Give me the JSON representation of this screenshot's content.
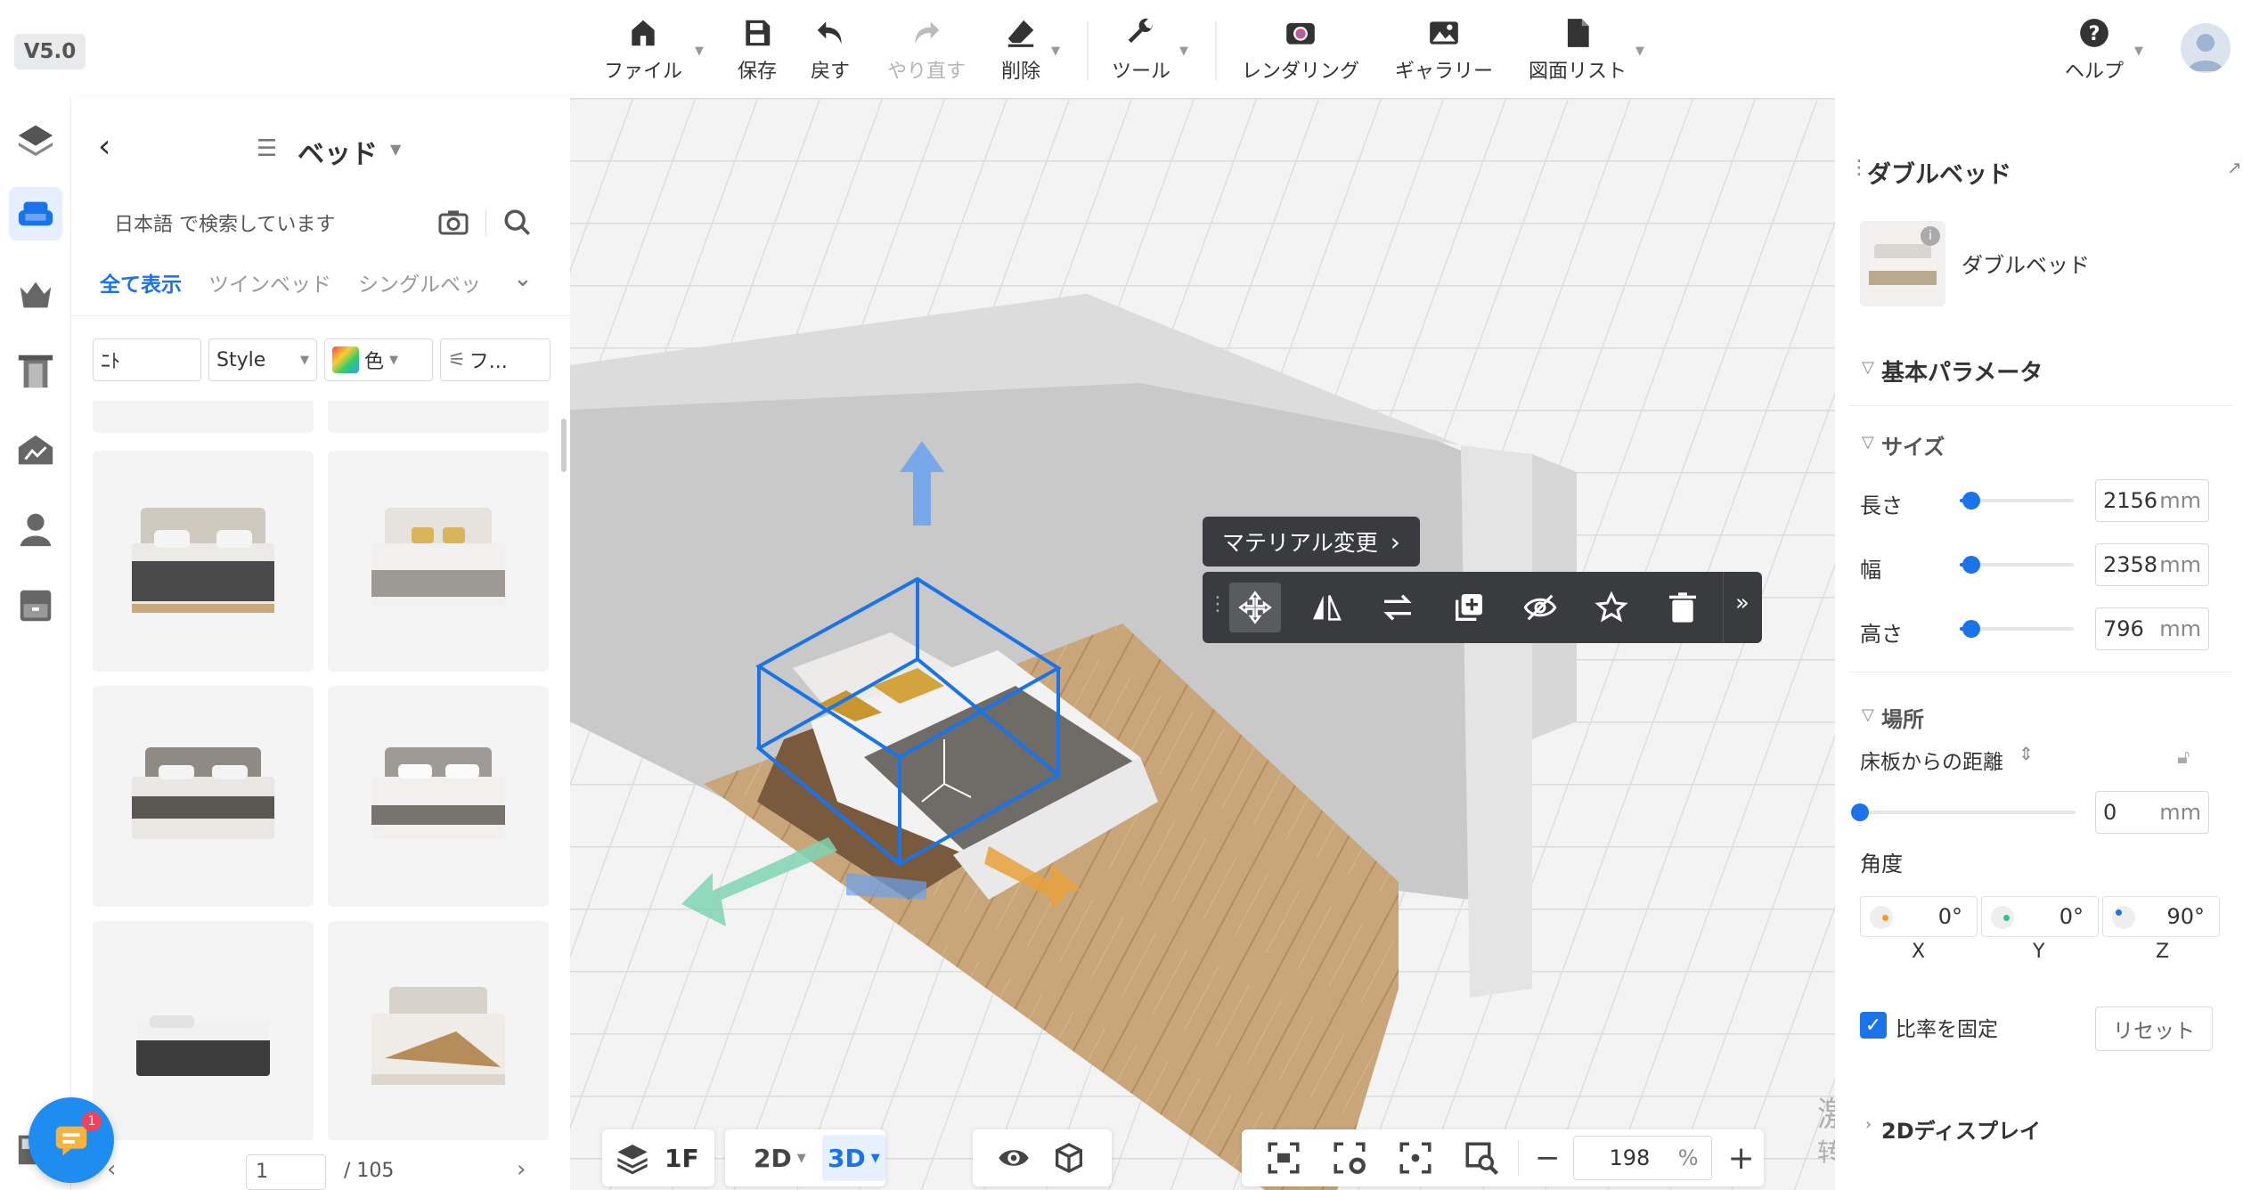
{
  "app": {
    "version": "V5.0"
  },
  "toolbar": {
    "file": "ファイル",
    "save": "保存",
    "undo": "戻す",
    "redo": "やり直す",
    "delete": "削除",
    "tools": "ツール",
    "rendering": "レンダリング",
    "gallery": "ギャラリー",
    "drawing_list": "図面リスト",
    "help": "ヘルプ"
  },
  "rail_icons": [
    "layers-icon",
    "sofa-icon",
    "decor-icon",
    "door-icon",
    "landscape-icon",
    "person-icon",
    "cabinet-icon"
  ],
  "catalog": {
    "title": "ベッド",
    "search_placeholder": "日本語 で検索しています",
    "tabs": [
      "全て表示",
      "ツインベッド",
      "シングルベッ"
    ],
    "filters": {
      "f1": "ﾆﾄ",
      "style": "Style",
      "color": "色",
      "more": "フ..."
    },
    "page": "1",
    "total": "/ 105"
  },
  "context_menu": {
    "material": "マテリアル変更"
  },
  "props": {
    "title": "ダブルベッド",
    "item_name": "ダブルベッド",
    "section_basic": "基本パラメータ",
    "section_size": "サイズ",
    "length_label": "長さ",
    "length": "2156",
    "width_label": "幅",
    "width": "2358",
    "height_label": "高さ",
    "height": "796",
    "unit": "mm",
    "section_place": "場所",
    "floor_dist_label": "床板からの距離",
    "floor_dist": "0",
    "angle_label": "角度",
    "angle_x": "0°",
    "angle_y": "0°",
    "angle_z": "90°",
    "axis_x": "X",
    "axis_y": "Y",
    "axis_z": "Z",
    "lock_ratio": "比率を固定",
    "reset": "リセット",
    "display_2d": "2Dディスプレイ"
  },
  "slider_levels": {
    "length": 0.1,
    "width": 0.1,
    "height": 0.1,
    "floor": 0.0
  },
  "bottom": {
    "floor": "1F",
    "mode_2d": "2D",
    "mode_3d": "3D",
    "zoom": "198",
    "pct": "%"
  },
  "watermark": {
    "line1": "激活 Windows",
    "line2": "转到\"设置\"以激活 Windows。"
  },
  "chat_badge": "1",
  "colors": {
    "accent": "#1a73e8",
    "toolbar_dark": "#3a3b3e"
  }
}
